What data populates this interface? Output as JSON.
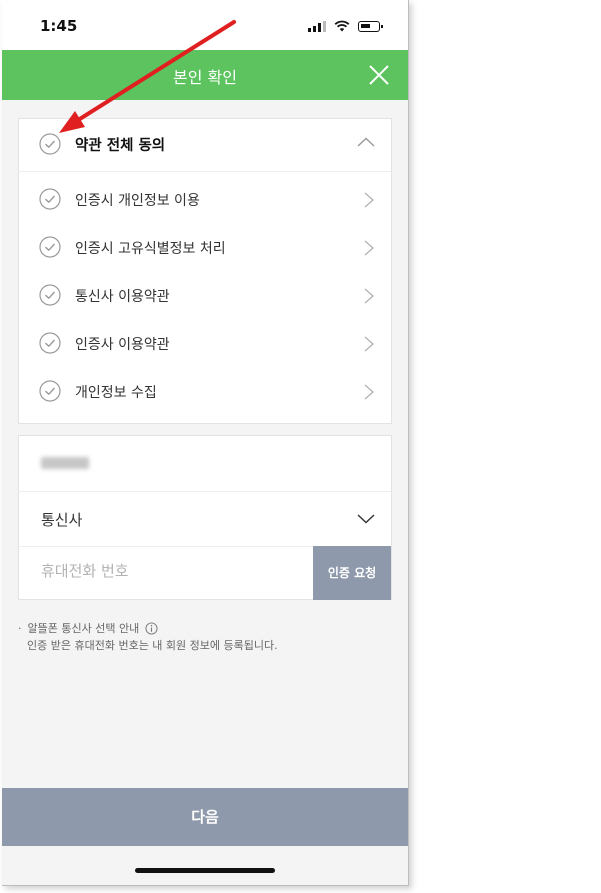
{
  "status_bar": {
    "time": "1:45"
  },
  "header": {
    "title": "본인 확인"
  },
  "agreements": {
    "all_label": "약관 전체 동의",
    "items": [
      {
        "label": "인증시 개인정보 이용"
      },
      {
        "label": "인증시 고유식별정보 처리"
      },
      {
        "label": "통신사 이용약관"
      },
      {
        "label": "인증사 이용약관"
      },
      {
        "label": "개인정보 수집"
      }
    ]
  },
  "form": {
    "carrier_label": "통신사",
    "phone_placeholder": "휴대전화 번호",
    "verify_button": "인증 요청"
  },
  "notice": {
    "line1": "알뜰폰 통신사 선택 안내",
    "line2": "인증 받은 휴대전화 번호는 내 회원 정보에 등록됩니다."
  },
  "footer": {
    "next_button": "다음"
  },
  "colors": {
    "header_green": "#5cc35f",
    "button_gray": "#8e9aab",
    "annotation_red": "#e02020"
  }
}
